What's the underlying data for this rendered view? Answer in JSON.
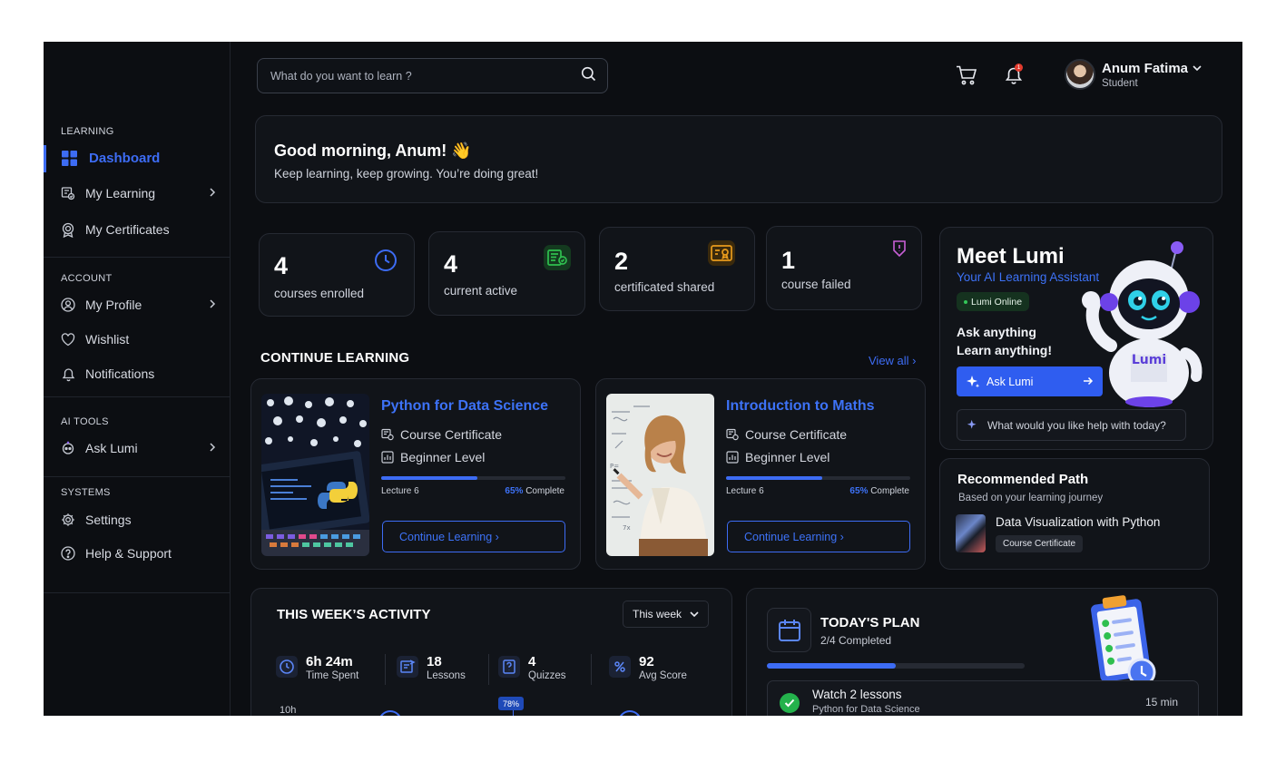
{
  "sidebar": {
    "sections": {
      "learning": "LEARNING",
      "account": "ACCOUNT",
      "ai_tools": "AI TOOLS",
      "systems": "SYSTEMS"
    },
    "items": {
      "dashboard": "Dashboard",
      "my_learning": "My Learning",
      "my_certificates": "My Certificates",
      "my_profile": "My Profile",
      "wishlist": "Wishlist",
      "notifications": "Notifications",
      "ask_lumi": "Ask Lumi",
      "settings": "Settings",
      "help": "Help & Support"
    }
  },
  "header": {
    "search_placeholder": "What do you want to learn ?",
    "notification_count": "1",
    "user": {
      "name": "Anum Fatima",
      "role": "Student"
    }
  },
  "greeting": {
    "title": "Good morning, Anum! 👋",
    "subtitle": "Keep learning, keep growing. You’re doing great!"
  },
  "stats": [
    {
      "value": "4",
      "label": "courses enrolled",
      "icon": "clock-icon",
      "color": "#3d6cf4"
    },
    {
      "value": "4",
      "label": "current active",
      "icon": "course-active-icon",
      "color": "#2fbf4f"
    },
    {
      "value": "2",
      "label": "certificated shared",
      "icon": "certificate-icon",
      "color": "#e89b1c"
    },
    {
      "value": "1",
      "label": "course failed",
      "icon": "failed-badge-icon",
      "color": "#c85fd6"
    }
  ],
  "continue_learning": {
    "title": "CONTINUE LEARNING",
    "view_all": "View all ›",
    "courses": [
      {
        "title": "Python for Data Science",
        "certificate": "Course Certificate",
        "level": "Beginner Level",
        "lecture": "Lecture 6",
        "percent": "65%",
        "complete": " Complete",
        "progress": 0.52,
        "button": "Continue Learning ›"
      },
      {
        "title": "Introduction to Maths",
        "certificate": "Course Certificate",
        "level": "Beginner Level",
        "lecture": "Lecture 6",
        "percent": "65%",
        "complete": " Complete",
        "progress": 0.52,
        "button": "Continue Learning ›"
      }
    ]
  },
  "lumi": {
    "title": "Meet Lumi",
    "subtitle": "Your AI Learning Assistant",
    "status": "Lumi Online",
    "line1": "Ask anything",
    "line2": "Learn anything!",
    "button": "Ask Lumi",
    "help_placeholder": "What would you like help with today?",
    "robot_label": "Lumi"
  },
  "recommended": {
    "title": "Recommended Path",
    "subtitle": "Based on your learning journey",
    "course": "Data Visualization with Python",
    "tag": "Course Certificate"
  },
  "activity": {
    "title": "THIS WEEK’S ACTIVITY",
    "period": "This week",
    "metrics": [
      {
        "value": "6h 24m",
        "label": "Time Spent",
        "icon": "clock-icon"
      },
      {
        "value": "18",
        "label": "Lessons",
        "icon": "lessons-icon"
      },
      {
        "value": "4",
        "label": "Quizzes",
        "icon": "quiz-icon"
      },
      {
        "value": "92",
        "label": "Avg Score",
        "icon": "score-icon"
      }
    ],
    "y_label": "10h",
    "highlight": "78%"
  },
  "plan": {
    "title": "TODAY'S PLAN",
    "subtitle": "2/4 Completed",
    "progress": 0.5,
    "task": {
      "title": "Watch 2 lessons",
      "subtitle": "Python for Data Science",
      "time": "15 min"
    }
  }
}
